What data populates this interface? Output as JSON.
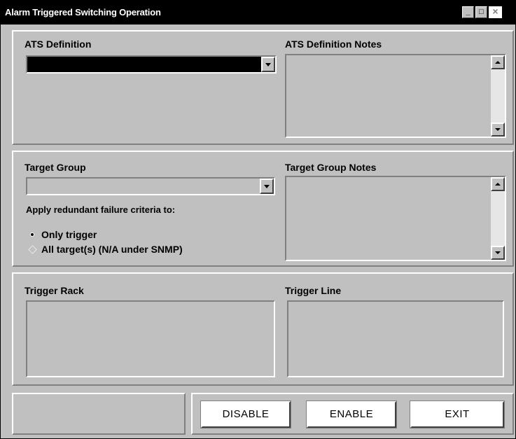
{
  "window": {
    "title": "Alarm Triggered Switching Operation",
    "controls": {
      "minimize": "_",
      "maximize": "□",
      "close": "×"
    }
  },
  "ats_section": {
    "definition_label": "ATS Definition",
    "definition_selected_value": "",
    "notes_label": "ATS Definition Notes",
    "notes_text": ""
  },
  "target_section": {
    "group_label": "Target Group",
    "group_selected_value": "",
    "notes_label": "Target Group Notes",
    "notes_text": "",
    "criteria_label": "Apply redundant failure criteria to:",
    "options": [
      {
        "label": "Only trigger",
        "selected": true,
        "enabled": true
      },
      {
        "label": "All target(s)  (N/A under SNMP)",
        "selected": false,
        "enabled": false
      }
    ]
  },
  "trigger_section": {
    "rack_label": "Trigger Rack",
    "line_label": "Trigger Line"
  },
  "footer": {
    "status_text": "",
    "buttons": {
      "disable": "DISABLE",
      "enable": "ENABLE",
      "exit": "EXIT"
    }
  },
  "colors": {
    "face": "#c0c0c0",
    "titlebar": "#000000",
    "highlight": "#ffffff",
    "shadow": "#808080",
    "selected_combo": "#000000"
  }
}
